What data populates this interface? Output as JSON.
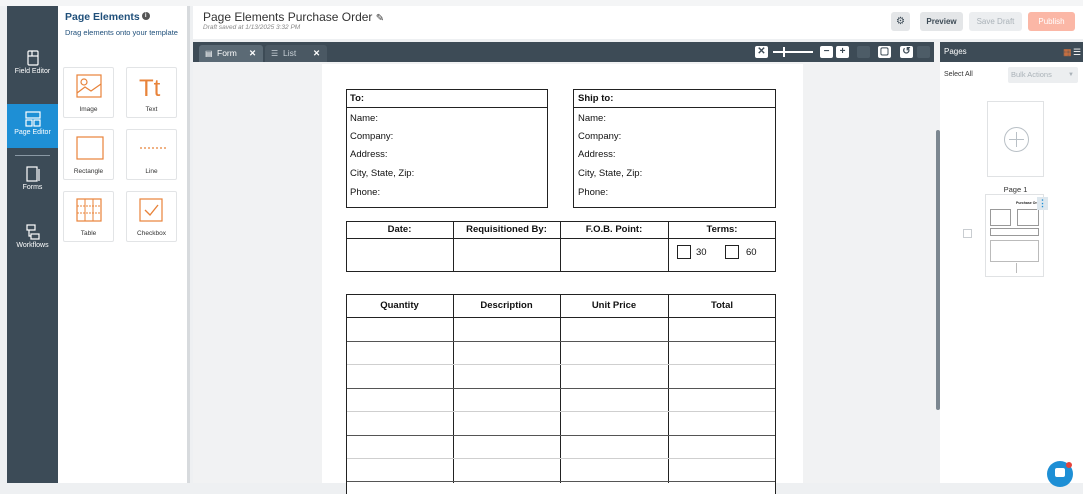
{
  "nav": {
    "items": [
      {
        "label": "Field Editor",
        "icon": "field-editor-icon"
      },
      {
        "label": "Page Editor",
        "icon": "page-editor-icon",
        "active": true
      },
      {
        "label": "Forms",
        "icon": "forms-icon"
      },
      {
        "label": "Workflows",
        "icon": "workflows-icon"
      }
    ]
  },
  "elements_panel": {
    "title": "Page Elements",
    "subtitle": "Drag elements onto your template",
    "tiles": [
      "Image",
      "Text",
      "Rectangle",
      "Line",
      "Table",
      "Checkbox"
    ]
  },
  "header": {
    "title": "Page Elements Purchase Order",
    "draft_status": "Draft saved at 1/13/2025 3:32 PM",
    "preview_label": "Preview",
    "save_draft_label": "Save Draft",
    "publish_label": "Publish"
  },
  "tabs": [
    {
      "label": "Form",
      "active": true
    },
    {
      "label": "List",
      "active": false
    }
  ],
  "form": {
    "to_title": "To:",
    "ship_title": "Ship to:",
    "address_fields": [
      "Name:",
      "Company:",
      "Address:",
      "City, State, Zip:",
      "Phone:"
    ],
    "info_headers": [
      "Date:",
      "Requisitioned By:",
      "F.O.B. Point:",
      "Terms:"
    ],
    "terms_options": [
      "30",
      "60"
    ],
    "items_headers": [
      "Quantity",
      "Description",
      "Unit Price",
      "Total"
    ]
  },
  "pages_panel": {
    "title": "Pages",
    "select_all_label": "Select All",
    "bulk_actions_label": "Bulk Actions",
    "page_label": "Page 1",
    "thumb_title": "Purchase Order"
  },
  "colors": {
    "accent_blue": "#1e8fd5",
    "nav_dark": "#3c4b57",
    "tile_orange": "#e8833a",
    "publish_bg": "#fbb7a6"
  }
}
